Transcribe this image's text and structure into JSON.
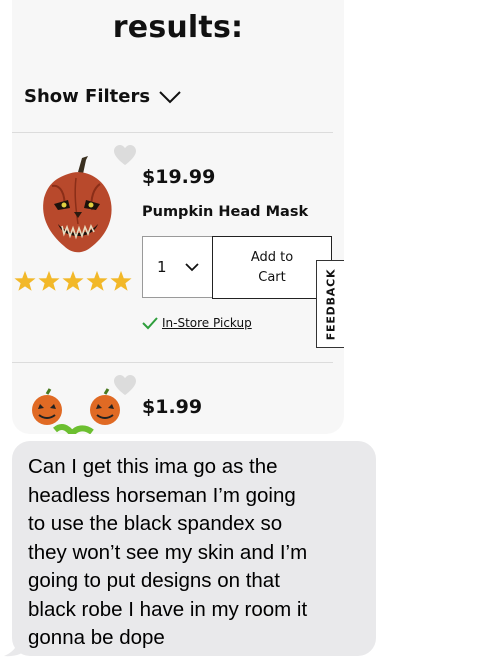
{
  "results": {
    "title": "results:",
    "filters_label": "Show Filters"
  },
  "product1": {
    "price": "$19.99",
    "name": "Pumpkin Head Mask",
    "rating_stars": 5,
    "quantity": "1",
    "add_to_cart": "Add to Cart",
    "pickup": "In-Store Pickup"
  },
  "product2": {
    "price": "$1.99"
  },
  "feedback_tab": "FEEDBACK",
  "message": {
    "text": "Can I get this ima go as the\nheadless horseman I’m going\nto use the black spandex so\nthey won’t see my skin and I’m\ngoing to put designs on that\nblack robe I have in my room it\ngonna be dope"
  },
  "colors": {
    "star": "#f2b829",
    "check": "#2e9e3c",
    "bubble": "#e9e9eb",
    "panel": "#f7f7f7"
  }
}
